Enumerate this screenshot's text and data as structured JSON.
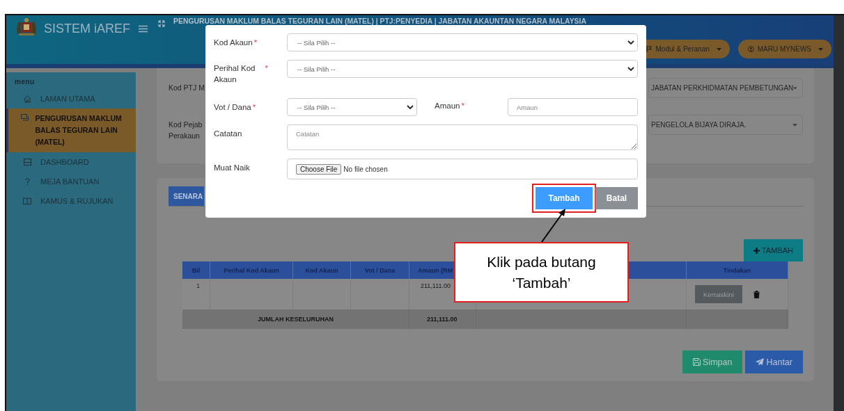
{
  "header": {
    "app_name": "SISTEM iAREF",
    "page_title": "PENGURUSAN MAKLUM BALAS TEGURAN LAIN (MATEL) | PTJ:PENYEDIA | JABATAN AKAUNTAN NEGARA MALAYSIA",
    "menus": [
      {
        "label": "Modul & Peranan",
        "kind": "module"
      },
      {
        "label": "MARU MYNEWS",
        "kind": "user"
      }
    ]
  },
  "sidebar": {
    "heading": "menu",
    "items": [
      {
        "label": "LAMAN UTAMA",
        "kind": "home",
        "selected": false
      },
      {
        "label": "PENGURUSAN MAKLUM BALAS TEGURAN LAIN (MATEL)",
        "kind": "windows",
        "selected": true
      },
      {
        "label": "DASHBOARD",
        "kind": "dashboard",
        "selected": false
      },
      {
        "label": "MEJA BANTUAN",
        "kind": "help",
        "selected": false
      },
      {
        "label": "KAMUS & RUJUKAN",
        "kind": "book",
        "selected": false
      }
    ]
  },
  "info_form": {
    "fields": [
      {
        "label": "Kod PTJ M",
        "value": "JABATAN PERKHIDMATAN PEMBETUNGAN"
      },
      {
        "label": "Kod Pejab\nPerakaun",
        "value": "PENGELOLA BIJAYA DIRAJA."
      }
    ]
  },
  "list_panel": {
    "tabs": [
      {
        "label": "SENARA",
        "selected": true
      }
    ],
    "add_button": "TAMBAH",
    "table": {
      "columns": [
        {
          "label": "Bil"
        },
        {
          "label": "Perihal Kod Akaun"
        },
        {
          "label": "Kod Akaun"
        },
        {
          "label": "Vot / Dana"
        },
        {
          "label": "Amaun (RM"
        }
      ],
      "action_column": "Tindakan",
      "rows": [
        {
          "bil": "1",
          "amount": "211,111.00",
          "edit_button": "Kemaskini"
        }
      ],
      "total": {
        "label": "JUMLAH KESELURUHAN",
        "amount": "211,111.00"
      }
    },
    "buttons": [
      {
        "label": "Simpan",
        "kind": "save"
      },
      {
        "label": "Hantar",
        "kind": "send"
      }
    ]
  },
  "modal": {
    "rows": [
      [
        {
          "label": "Kod Akaun",
          "required_mark": "*",
          "kind": "select",
          "placeholder": "-- Sila Pilih --"
        }
      ],
      [
        {
          "label": "Perihal Kod\nAkaun",
          "required_mark": "*",
          "kind": "select",
          "placeholder": "-- Sila Pilih --"
        }
      ],
      [
        {
          "label": "Vot / Dana",
          "required_mark": "*",
          "kind": "select",
          "placeholder": "-- Sila Pilih --"
        },
        {
          "label": "Amaun",
          "required_mark": "*",
          "kind": "text",
          "placeholder": "Amaun"
        }
      ],
      [
        {
          "label": "Catatan",
          "kind": "textarea",
          "placeholder": "Catatan"
        }
      ],
      [
        {
          "label": "Muat Naik",
          "kind": "file",
          "button": "Choose File",
          "status": "No file chosen"
        }
      ]
    ],
    "buttons": [
      {
        "label": "Tambah",
        "kind": "primary",
        "highlighted": true
      },
      {
        "label": "Batal",
        "kind": "secondary",
        "highlighted": false
      }
    ]
  },
  "callout": {
    "text": "Klik pada butang ‘Tambah’"
  }
}
